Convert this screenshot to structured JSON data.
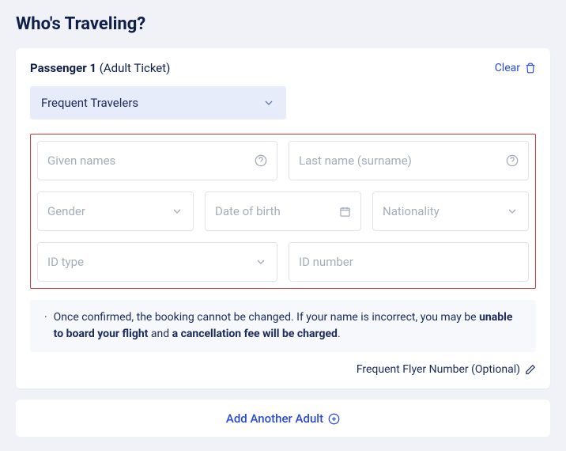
{
  "page": {
    "title": "Who's Traveling?"
  },
  "passenger": {
    "label": "Passenger 1",
    "ticketType": "(Adult Ticket)",
    "clearLabel": "Clear",
    "freqTravelersLabel": "Frequent Travelers",
    "fields": {
      "givenNames": "Given names",
      "lastName": "Last name (surname)",
      "gender": "Gender",
      "dob": "Date of birth",
      "nationality": "Nationality",
      "idType": "ID type",
      "idNumber": "ID number"
    },
    "notice": {
      "prefix": "Once confirmed, the booking cannot be changed. If your name is incorrect, you may be ",
      "bold1": "unable to board your flight",
      "mid": " and ",
      "bold2": "a cancellation fee will be charged",
      "suffix": "."
    },
    "ffnLabel": "Frequent Flyer Number (Optional)"
  },
  "addButton": {
    "label": "Add Another Adult"
  }
}
